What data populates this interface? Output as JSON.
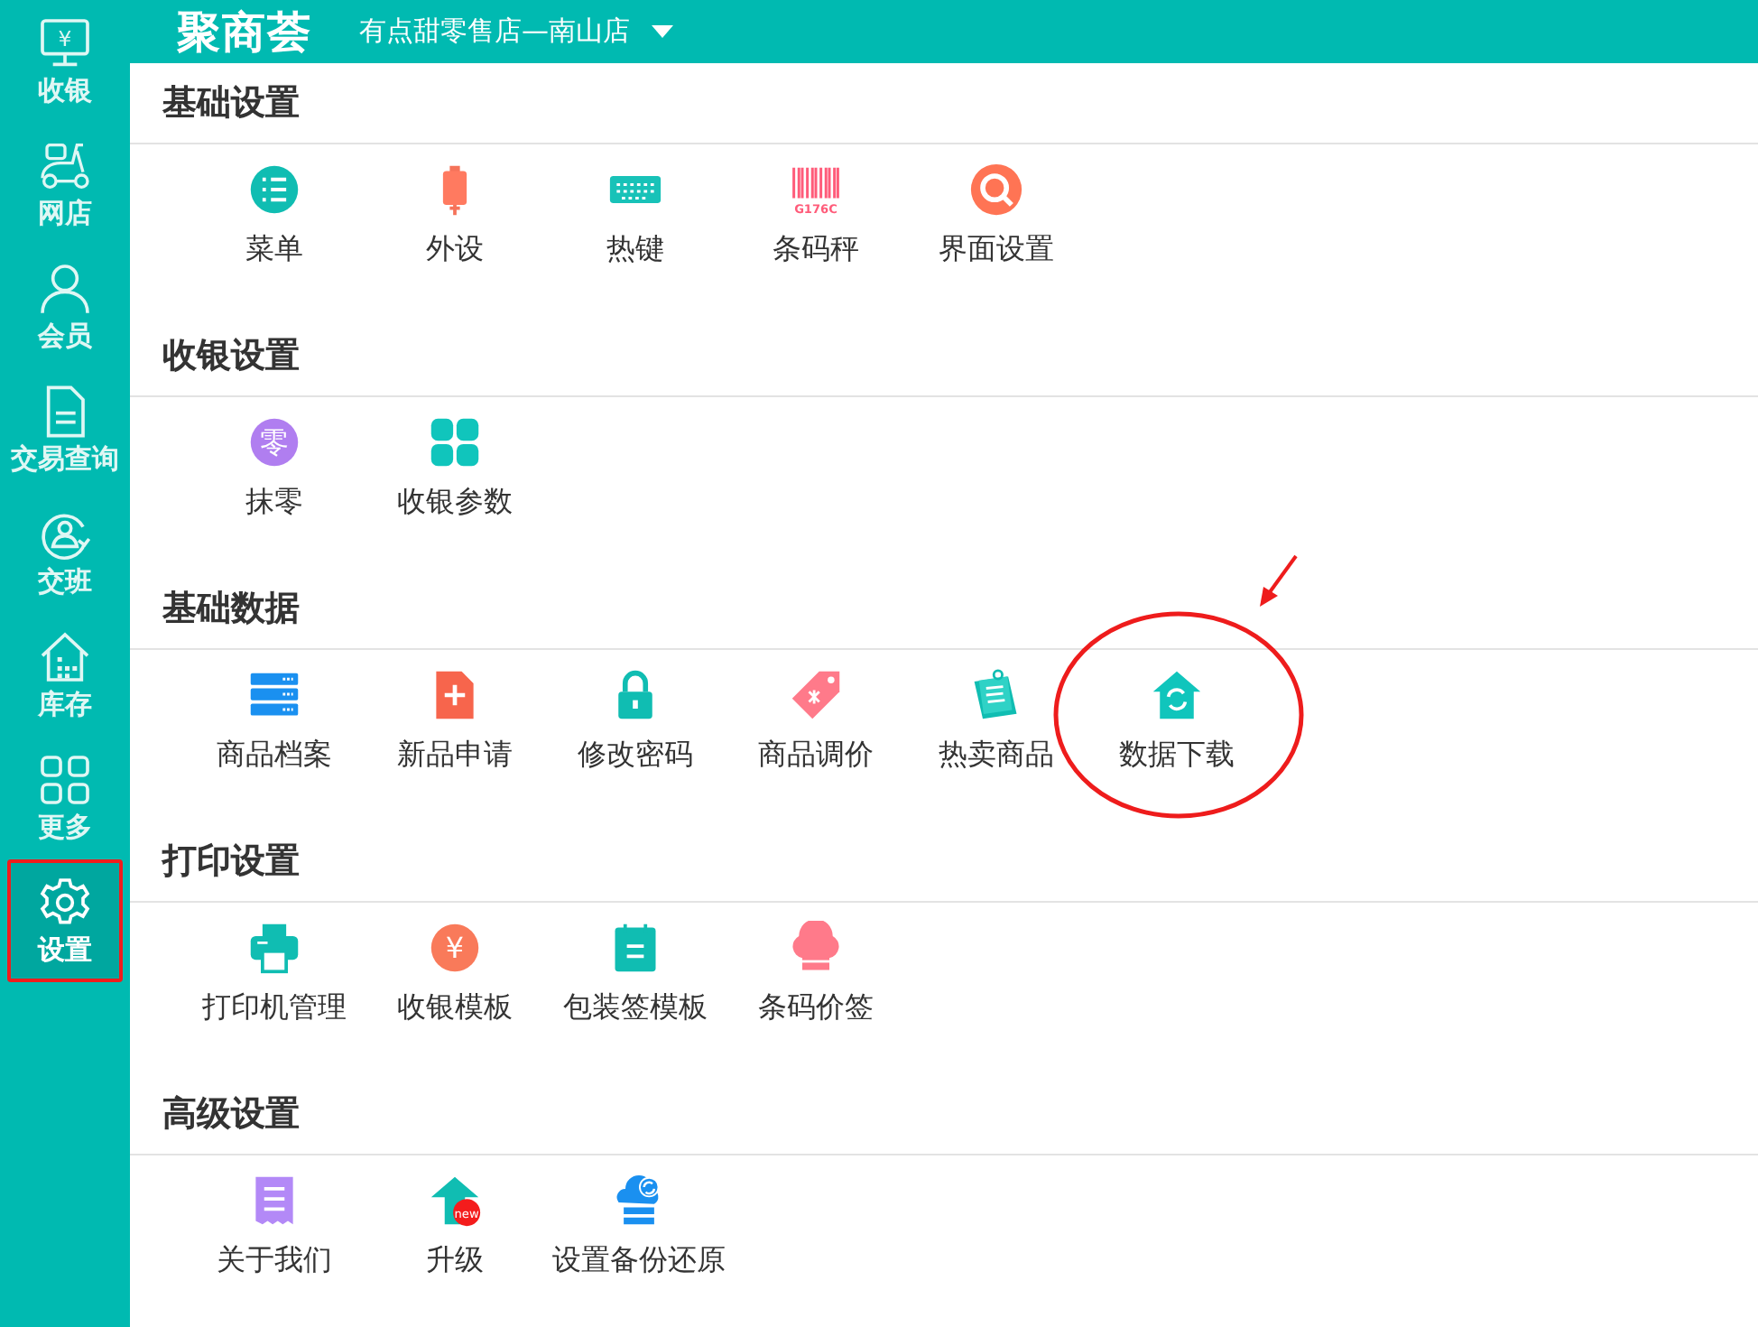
{
  "header": {
    "logo": "聚商荟",
    "store": "有点甜零售店—南山店"
  },
  "sidebar": {
    "items": [
      {
        "label": "收银",
        "kind": "monitor",
        "icon_text": "¥",
        "selected": false,
        "highlighted": false
      },
      {
        "label": "网店",
        "kind": "scooter",
        "selected": false,
        "highlighted": false
      },
      {
        "label": "会员",
        "kind": "person",
        "selected": false,
        "highlighted": false
      },
      {
        "label": "交易查询",
        "kind": "document",
        "selected": false,
        "highlighted": false
      },
      {
        "label": "交班",
        "kind": "handover",
        "selected": false,
        "highlighted": false
      },
      {
        "label": "库存",
        "kind": "house",
        "selected": false,
        "highlighted": false
      },
      {
        "label": "更多",
        "kind": "grid",
        "selected": false,
        "highlighted": false
      },
      {
        "label": "设置",
        "kind": "gear",
        "selected": true,
        "highlighted": true
      }
    ]
  },
  "sections": [
    {
      "title": "基础设置",
      "items": [
        {
          "label": "菜单",
          "kind": "list",
          "highlighted": false
        },
        {
          "label": "外设",
          "kind": "peripheral",
          "highlighted": false
        },
        {
          "label": "热键",
          "kind": "keyboard",
          "highlighted": false
        },
        {
          "label": "条码秤",
          "kind": "barcode",
          "icon_text": "G176C",
          "highlighted": false
        },
        {
          "label": "界面设置",
          "kind": "search",
          "highlighted": false
        }
      ]
    },
    {
      "title": "收银设置",
      "items": [
        {
          "label": "抹零",
          "kind": "coin",
          "icon_text": "零",
          "color": "#b07ef0",
          "highlighted": false
        },
        {
          "label": "收银参数",
          "kind": "tiles",
          "highlighted": false
        }
      ]
    },
    {
      "title": "基础数据",
      "items": [
        {
          "label": "商品档案",
          "kind": "server",
          "highlighted": false
        },
        {
          "label": "新品申请",
          "kind": "fileplus",
          "highlighted": false
        },
        {
          "label": "修改密码",
          "kind": "lock",
          "highlighted": false
        },
        {
          "label": "商品调价",
          "kind": "tag",
          "highlighted": false
        },
        {
          "label": "热卖商品",
          "kind": "notes",
          "highlighted": false
        },
        {
          "label": "数据下载",
          "kind": "homesync",
          "highlighted": true
        }
      ]
    },
    {
      "title": "打印设置",
      "items": [
        {
          "label": "打印机管理",
          "kind": "printer",
          "highlighted": false
        },
        {
          "label": "收银模板",
          "kind": "coin",
          "icon_text": "¥",
          "color": "#f97a5a",
          "highlighted": false
        },
        {
          "label": "包装签模板",
          "kind": "calendar",
          "highlighted": false
        },
        {
          "label": "条码价签",
          "kind": "hat",
          "highlighted": false
        }
      ]
    },
    {
      "title": "高级设置",
      "items": [
        {
          "label": "关于我们",
          "kind": "receipt",
          "highlighted": false
        },
        {
          "label": "升级",
          "kind": "upgrade",
          "icon_text": "new",
          "highlighted": false
        },
        {
          "label": "设置备份还原",
          "kind": "cloud",
          "highlighted": false
        }
      ]
    }
  ]
}
